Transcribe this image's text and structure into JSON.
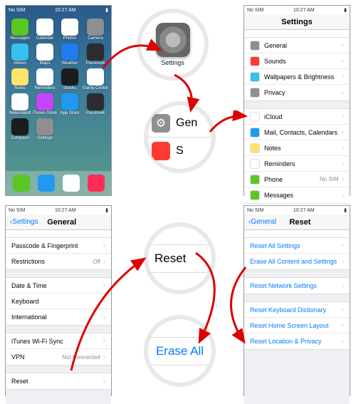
{
  "status": {
    "carrier": "No SIM",
    "time": "10:27 AM"
  },
  "home": {
    "apps": [
      {
        "n": "Messages",
        "c": "#5ac723"
      },
      {
        "n": "Calendar",
        "c": "#fff"
      },
      {
        "n": "Photos",
        "c": "#fff"
      },
      {
        "n": "Camera",
        "c": "#8e8e93"
      },
      {
        "n": "Videos",
        "c": "#37c1f0"
      },
      {
        "n": "Maps",
        "c": "#fff"
      },
      {
        "n": "Weather",
        "c": "#1f7cf1"
      },
      {
        "n": "Passbook",
        "c": "#2c2c2e"
      },
      {
        "n": "Notes",
        "c": "#ffe46c"
      },
      {
        "n": "Reminders",
        "c": "#fff"
      },
      {
        "n": "Stocks",
        "c": "#1c1c1e"
      },
      {
        "n": "Game Center",
        "c": "#fff"
      },
      {
        "n": "Newsstand",
        "c": "#fff"
      },
      {
        "n": "iTunes Store",
        "c": "#c643fc"
      },
      {
        "n": "App Store",
        "c": "#1f9af0"
      },
      {
        "n": "Passbook",
        "c": "#2c2c2e"
      },
      {
        "n": "Compass",
        "c": "#1c1c1e"
      },
      {
        "n": "Settings",
        "c": "#8e8e93"
      }
    ],
    "dock": [
      {
        "n": "Phone",
        "c": "#5ac723"
      },
      {
        "n": "Mail",
        "c": "#1f9af0"
      },
      {
        "n": "Safari",
        "c": "#fff"
      },
      {
        "n": "Music",
        "c": "#ff2d55"
      }
    ]
  },
  "settings": {
    "title": "Settings",
    "g1": [
      {
        "icon": "#8e8e93",
        "label": "General"
      },
      {
        "icon": "#ff3b30",
        "label": "Sounds"
      },
      {
        "icon": "#37c1f0",
        "label": "Wallpapers & Brightness"
      },
      {
        "icon": "#8e8e93",
        "label": "Privacy"
      }
    ],
    "g2": [
      {
        "icon": "#fff",
        "label": "iCloud"
      },
      {
        "icon": "#1f9af0",
        "label": "Mail, Contacts, Calendars"
      },
      {
        "icon": "#ffe46c",
        "label": "Notes"
      },
      {
        "icon": "#fff",
        "label": "Reminders"
      },
      {
        "icon": "#5ac723",
        "label": "Phone",
        "val": "No SIM"
      },
      {
        "icon": "#5ac723",
        "label": "Messages"
      }
    ]
  },
  "general": {
    "back": "Settings",
    "title": "General",
    "g1": [
      {
        "label": "Passcode & Fingerprint"
      },
      {
        "label": "Restrictions",
        "val": "Off"
      }
    ],
    "g2": [
      {
        "label": "Date & Time"
      },
      {
        "label": "Keyboard"
      },
      {
        "label": "International"
      }
    ],
    "g3": [
      {
        "label": "iTunes Wi-Fi Sync"
      },
      {
        "label": "VPN",
        "val": "Not Connected"
      }
    ],
    "g4": [
      {
        "label": "Reset"
      }
    ]
  },
  "reset": {
    "back": "General",
    "title": "Reset",
    "g1": [
      {
        "label": "Reset All Settings"
      },
      {
        "label": "Erase All Content and Settings"
      }
    ],
    "g2": [
      {
        "label": "Reset Network Settings"
      }
    ],
    "g3": [
      {
        "label": "Reset Keyboard Dictionary"
      },
      {
        "label": "Reset Home Screen Layout"
      },
      {
        "label": "Reset Location & Privacy"
      }
    ]
  },
  "circle1": {
    "label": "Settings"
  },
  "circle2": {
    "label": "Gen"
  },
  "circle3": {
    "label": "Reset"
  },
  "circle4": {
    "label": "Erase All"
  }
}
